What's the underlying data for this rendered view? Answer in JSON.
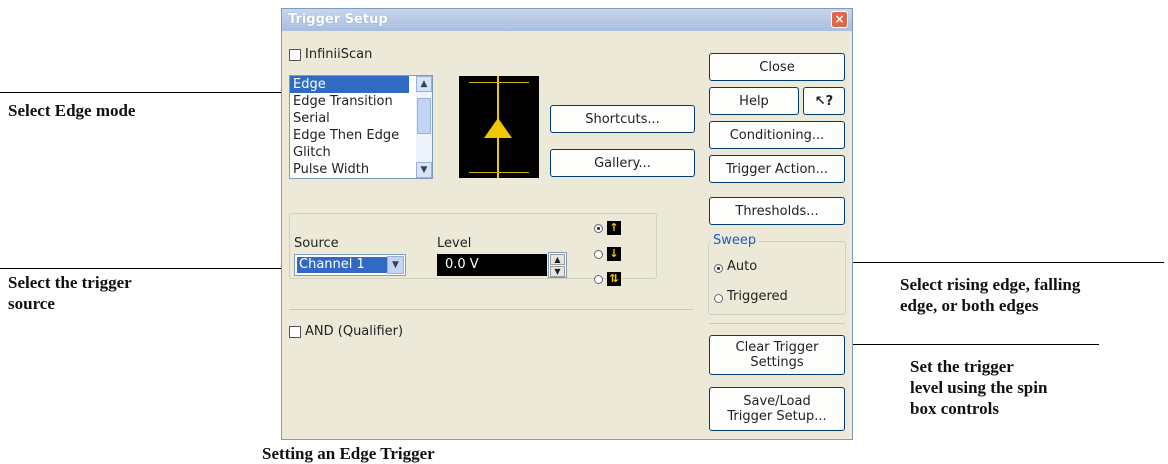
{
  "dialog": {
    "title": "Trigger Setup",
    "close_glyph": "×",
    "infiniiscan_label": "InfiniiScan",
    "modes": [
      "Edge",
      "Edge Transition",
      "Serial",
      "Edge Then Edge",
      "Glitch",
      "Pulse Width"
    ],
    "selected_mode": "Edge",
    "shortcuts_label": "Shortcuts...",
    "gallery_label": "Gallery...",
    "source_label": "Source",
    "source_value": "Channel 1",
    "level_label": "Level",
    "level_value": "0.0 V",
    "slope_options": [
      "rising-edge-icon",
      "falling-edge-icon",
      "both-edges-icon"
    ],
    "selected_slope": "rising-edge-icon",
    "and_qualifier_label": "AND (Qualifier)",
    "right_buttons": {
      "close": "Close",
      "help": "Help",
      "help_pointer_glyph": "↖?",
      "conditioning": "Conditioning...",
      "trigger_action": "Trigger Action...",
      "thresholds": "Thresholds...",
      "clear_line1": "Clear Trigger",
      "clear_line2": "Settings",
      "save_line1": "Save/Load",
      "save_line2": "Trigger Setup..."
    },
    "sweep": {
      "label": "Sweep",
      "auto": "Auto",
      "triggered": "Triggered",
      "selected": "Auto"
    }
  },
  "annotations": {
    "edge_mode": "Select Edge mode",
    "source_line1": "Select the trigger",
    "source_line2": "source",
    "slope_line1": "Select rising edge, falling",
    "slope_line2": "edge, or both edges",
    "level_line1": "Set the trigger",
    "level_line2": "level using the spin",
    "level_line3": "box controls",
    "caption": "Setting an Edge Trigger"
  },
  "colors": {
    "dialog_bg": "#ece9d8",
    "selection": "#316ac5",
    "preview_trace": "#f0c800"
  }
}
